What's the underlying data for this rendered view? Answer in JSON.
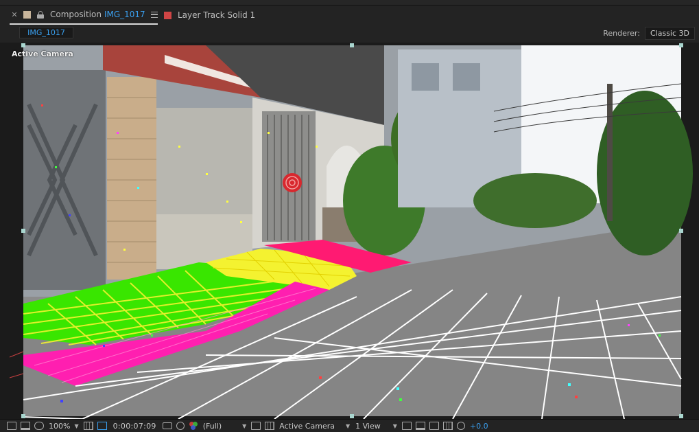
{
  "tabs": {
    "composition": {
      "prefix": "Composition",
      "name": "IMG_1017",
      "label_color": "#c7b49a"
    },
    "layer": {
      "label": "Layer Track Solid 1",
      "label_color": "#d04545"
    }
  },
  "comp_tab": "IMG_1017",
  "renderer": {
    "label": "Renderer:",
    "value": "Classic 3D"
  },
  "viewer": {
    "camera_label": "Active Camera"
  },
  "bottombar": {
    "zoom": "100%",
    "timecode": "0:00:07:09",
    "resolution": "(Full)",
    "view": "Active Camera",
    "view_layout": "1 View",
    "exposure": "+0.0"
  },
  "overlay_colors": {
    "green_plane": "#39e600",
    "yellow_plane": "#f4f230",
    "magenta_plane": "#ff1fb0",
    "red_plane": "#ff1a72",
    "grid_lines": "#ffffff",
    "target": "#d8282e"
  }
}
